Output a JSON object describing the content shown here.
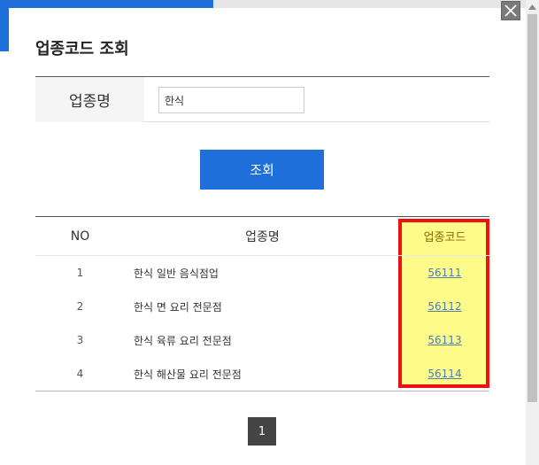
{
  "dialog": {
    "title": "업종코드 조회",
    "close_icon": "close-icon"
  },
  "search": {
    "label": "업종명",
    "value": "한식",
    "button_label": "조회"
  },
  "table": {
    "columns": [
      "NO",
      "업종명",
      "업종코드"
    ],
    "rows": [
      {
        "no": "1",
        "name": "한식 일반 음식점업",
        "code": "56111"
      },
      {
        "no": "2",
        "name": "한식 면 요리 전문점",
        "code": "56112"
      },
      {
        "no": "3",
        "name": "한식 육류 요리 전문점",
        "code": "56113"
      },
      {
        "no": "4",
        "name": "한식 해산물 요리 전문점",
        "code": "56114"
      }
    ]
  },
  "pagination": {
    "current_page": "1"
  },
  "colors": {
    "accent": "#1e6fd9",
    "highlight_fill": "#fffb8a",
    "highlight_border": "#ee1111"
  }
}
